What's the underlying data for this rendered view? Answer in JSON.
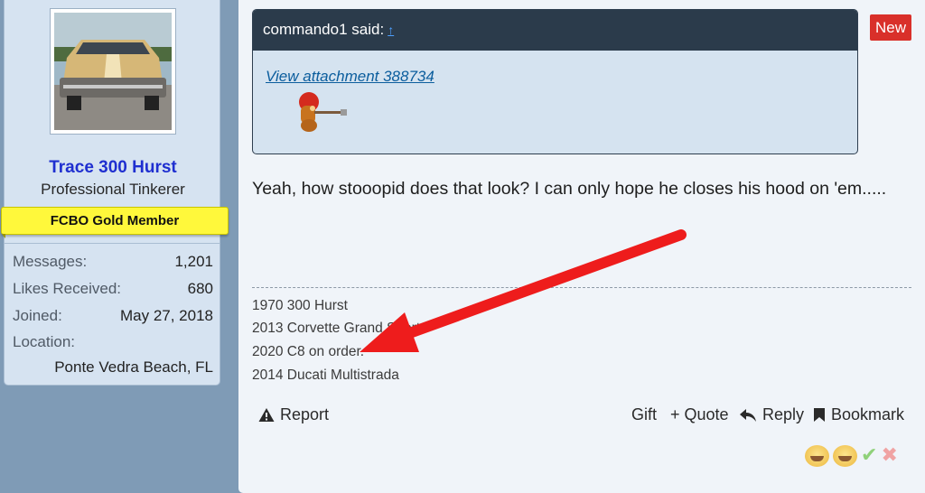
{
  "user": {
    "name": "Trace 300 Hurst",
    "title": "Professional Tinkerer",
    "banner": "FCBO Gold Member",
    "stats": [
      {
        "label": "Messages:",
        "value": "1,201"
      },
      {
        "label": "Likes Received:",
        "value": "680"
      },
      {
        "label": "Joined:",
        "value": "May 27, 2018"
      },
      {
        "label": "Location:",
        "value": "Ponte Vedra Beach, FL"
      }
    ]
  },
  "quote": {
    "author": "commando1 said:",
    "jump": "↑",
    "attachment_link": "View attachment 388734"
  },
  "badge": "New",
  "post": {
    "text": "Yeah, how stooopid does that look? I can only hope he closes his hood on 'em....."
  },
  "signature": [
    "1970 300 Hurst",
    "2013 Corvette Grand Sport",
    "2020 C8 on order.",
    "2014 Ducati Multistrada"
  ],
  "actions": {
    "report": "Report",
    "gift": "Gift",
    "quote": "+ Quote",
    "reply": "Reply",
    "bookmark": "Bookmark"
  },
  "icons": [
    "warning-icon",
    "reply-icon",
    "bookmark-icon",
    "laugh-emoji-icon",
    "check-icon",
    "x-icon"
  ],
  "colors": {
    "username": "#1f2fd0",
    "banner": "#fff83b",
    "new_badge": "#d9302a",
    "quote_header": "#2b3b4b",
    "arrow": "#ee1c1c"
  }
}
